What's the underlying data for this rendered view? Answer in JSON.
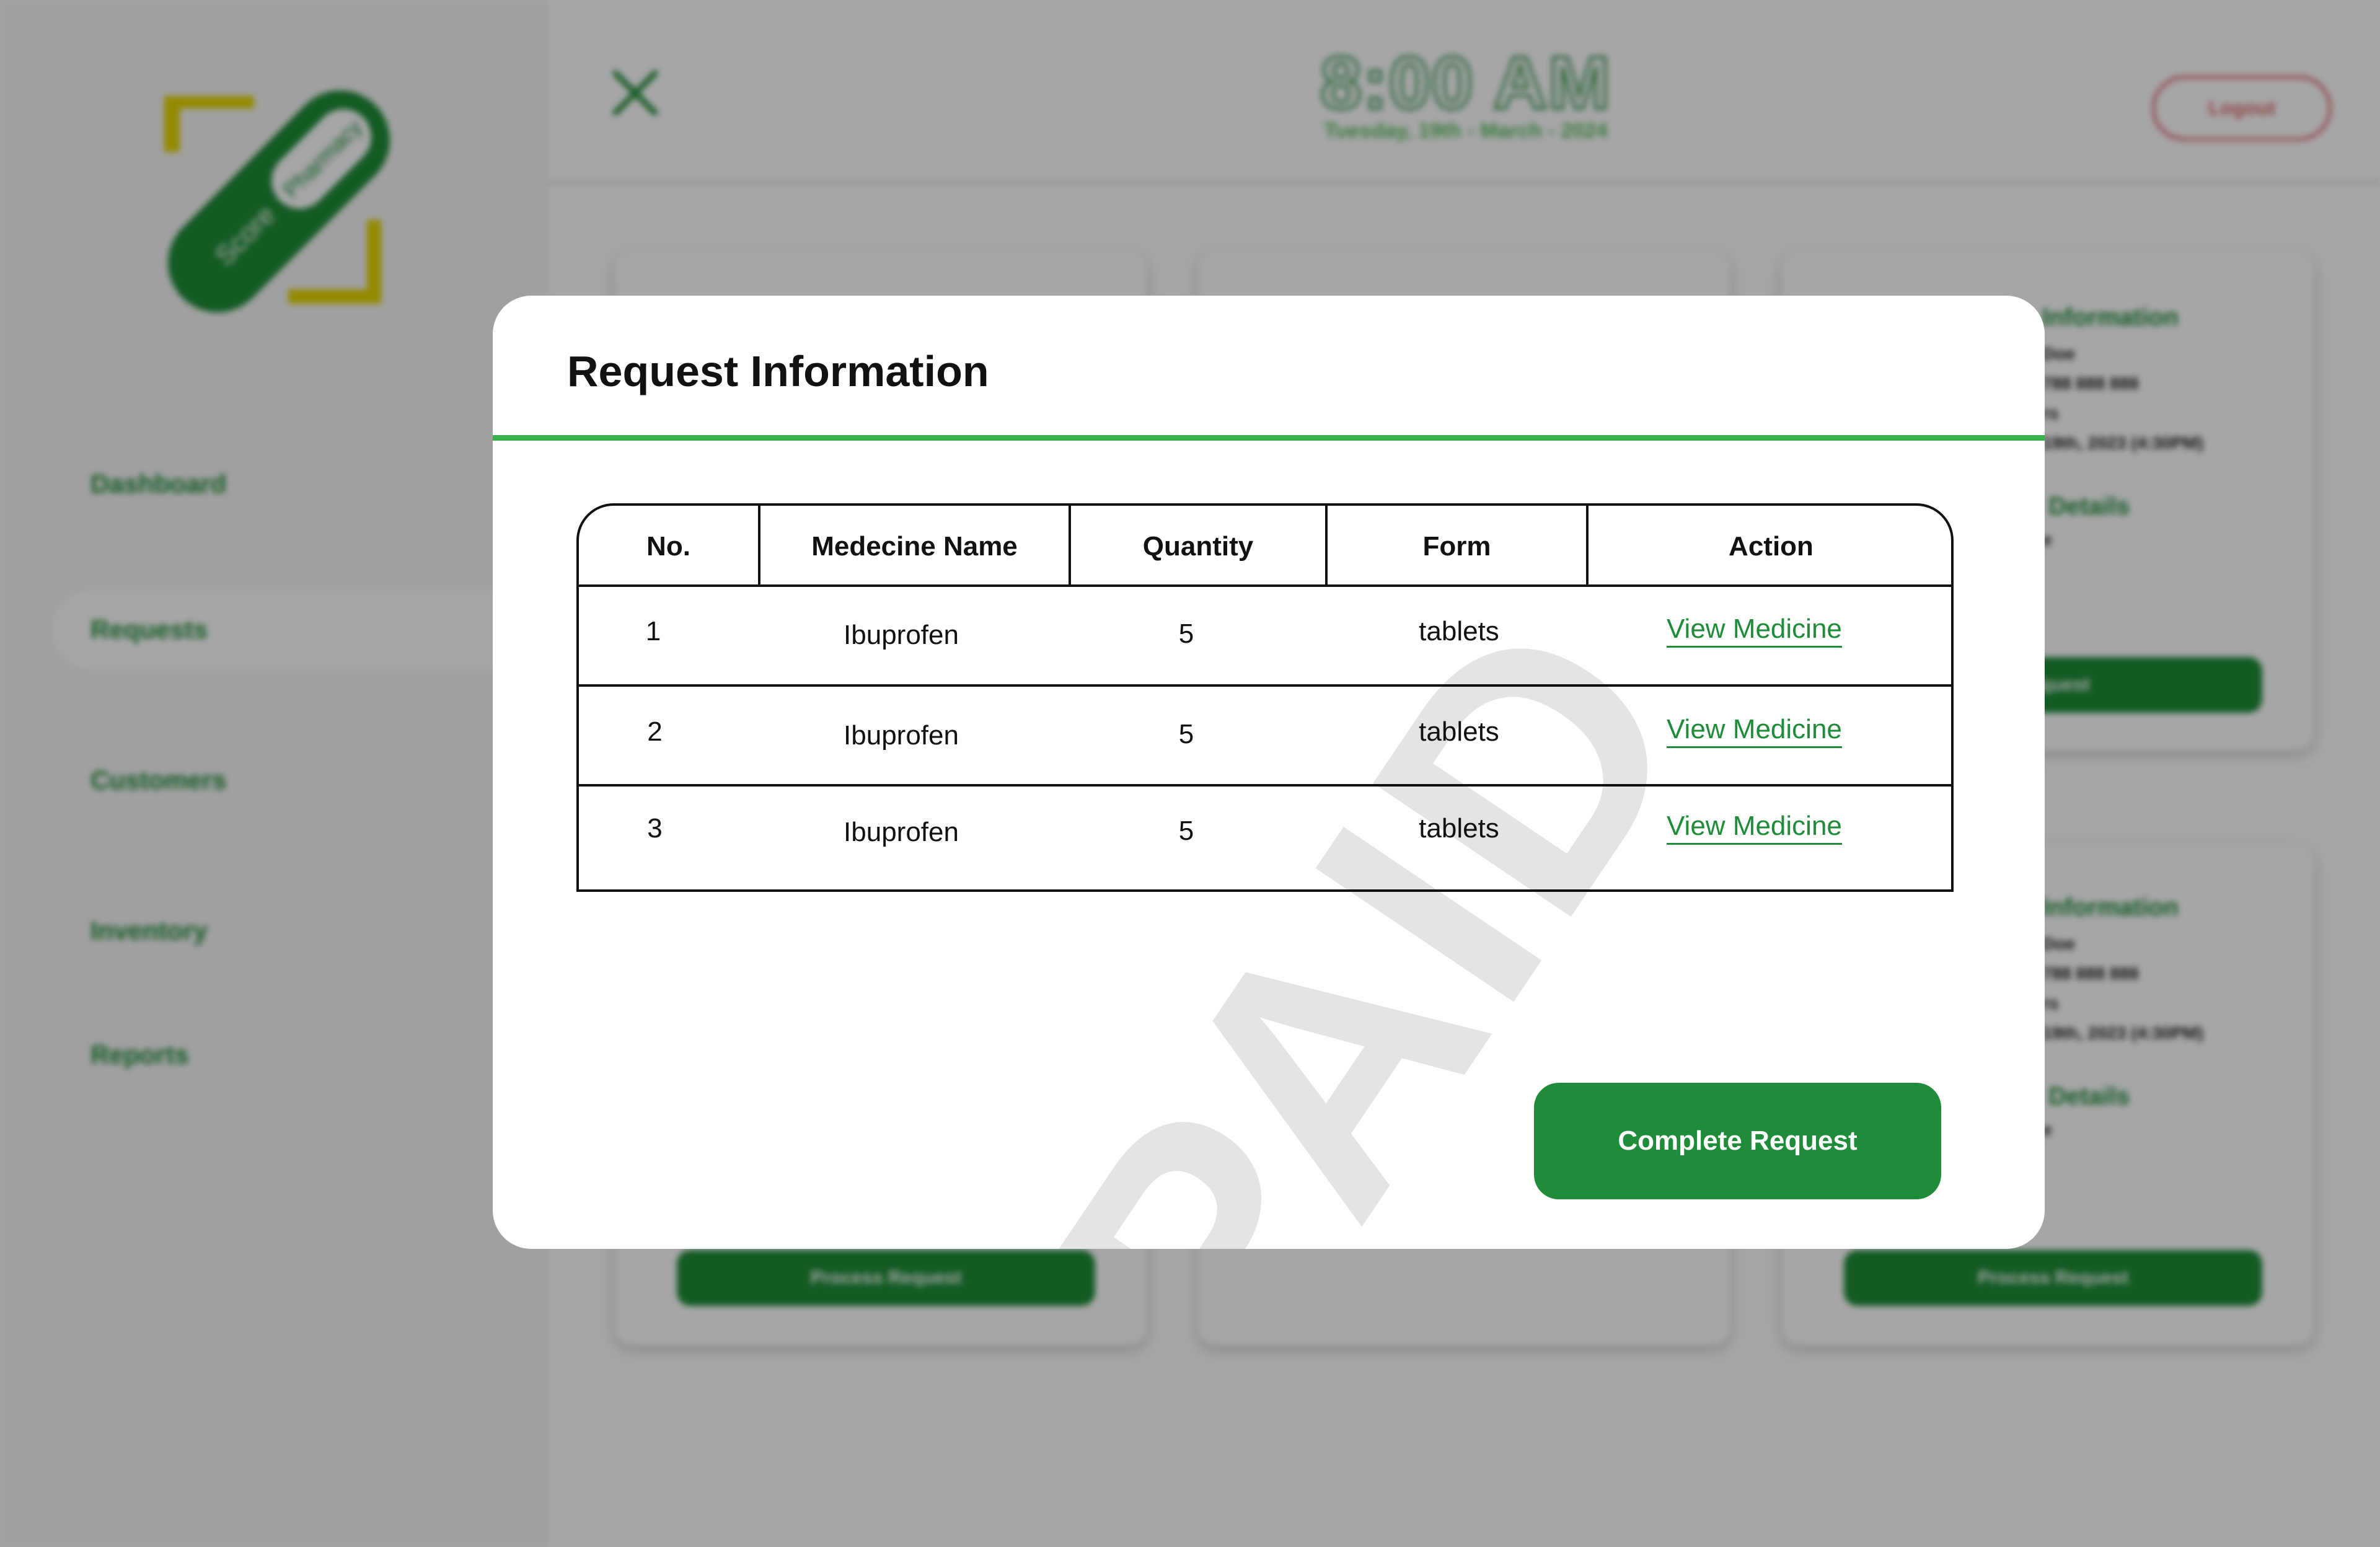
{
  "app": {
    "logo_text_1": "Score",
    "logo_text_2": "Pharmacy",
    "colors": {
      "brand_green": "#1e8c38",
      "accent_yellow": "#e4d400",
      "divider_green": "#35b44a",
      "logout_red": "#e06a6a"
    }
  },
  "sidebar": {
    "items": [
      {
        "label": "Dashboard"
      },
      {
        "label": "Requests"
      },
      {
        "label": "Customers"
      },
      {
        "label": "Inventory"
      },
      {
        "label": "Reports"
      }
    ]
  },
  "header": {
    "time": "8:00 AM",
    "date": "Tuesday, 19th - March - 2024",
    "logout_label": "Logout"
  },
  "background_cards": [
    {
      "title": "Information",
      "name": "Doe",
      "phone": "788 888 888",
      "meta": "rs",
      "date": "19th, 2023 (4:30PM)",
      "details": "Details",
      "details_meta": "e",
      "button": "Request"
    },
    {
      "title": "Information",
      "name": "Doe",
      "phone": "788 888 888",
      "meta": "rs",
      "date": "19th, 2023 (4:30PM)",
      "details": "Details",
      "details_meta": "e",
      "button": "Process Request"
    },
    {
      "button": "Process Request"
    }
  ],
  "modal": {
    "title": "Request Information",
    "stamp": "PAID",
    "columns": [
      "No.",
      "Medecine Name",
      "Quantity",
      "Form",
      "Action"
    ],
    "rows": [
      {
        "no": "1",
        "name": "Ibuprofen",
        "quantity": "5",
        "form": "tablets",
        "action": "View Medicine"
      },
      {
        "no": "2",
        "name": "Ibuprofen",
        "quantity": "5",
        "form": "tablets",
        "action": "View Medicine"
      },
      {
        "no": "3",
        "name": "Ibuprofen",
        "quantity": "5",
        "form": "tablets",
        "action": "View Medicine"
      }
    ],
    "complete_button": "Complete Request"
  }
}
